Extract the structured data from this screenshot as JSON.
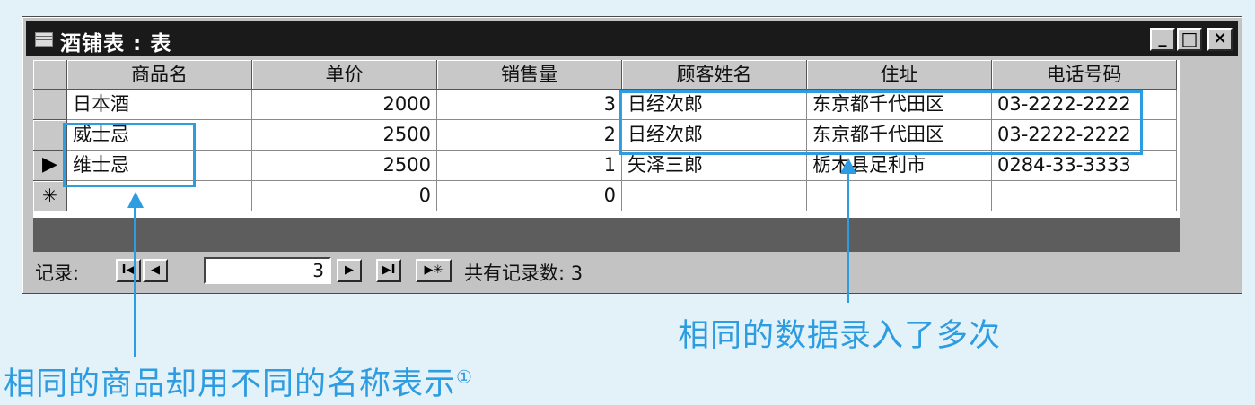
{
  "window": {
    "title": "酒铺表 : 表"
  },
  "window_buttons": {
    "minimize": "_",
    "maximize": "□",
    "close": "×"
  },
  "table": {
    "columns": [
      "商品名",
      "单价",
      "销售量",
      "顾客姓名",
      "住址",
      "电话号码"
    ],
    "rows": [
      [
        "日本酒",
        "2000",
        "3",
        "日经次郎",
        "东京都千代田区",
        "03-2222-2222"
      ],
      [
        "威士忌",
        "2500",
        "2",
        "日经次郎",
        "东京都千代田区",
        "03-2222-2222"
      ],
      [
        "维士忌",
        "2500",
        "1",
        "矢泽三郎",
        "栃木县足利市",
        "0284-33-3333"
      ],
      [
        "",
        "0",
        "0",
        "",
        "",
        ""
      ]
    ],
    "current_row_marker": "▶",
    "new_row_marker": "✳"
  },
  "navigation": {
    "label": "记录:",
    "current_record": "3",
    "total_label": "共有记录数: 3",
    "buttons": {
      "first": "I◀",
      "prev": "◀",
      "next": "▶",
      "last": "▶I",
      "new": "▶✳"
    }
  },
  "annotations": {
    "duplicate_data": "相同的数据录入了多次",
    "different_names": "相同的商品却用不同的名称表示",
    "footnote_mark": "①"
  },
  "colors": {
    "annotation_blue": "#2d9ce0",
    "title_bar": "#1a1a1a"
  }
}
